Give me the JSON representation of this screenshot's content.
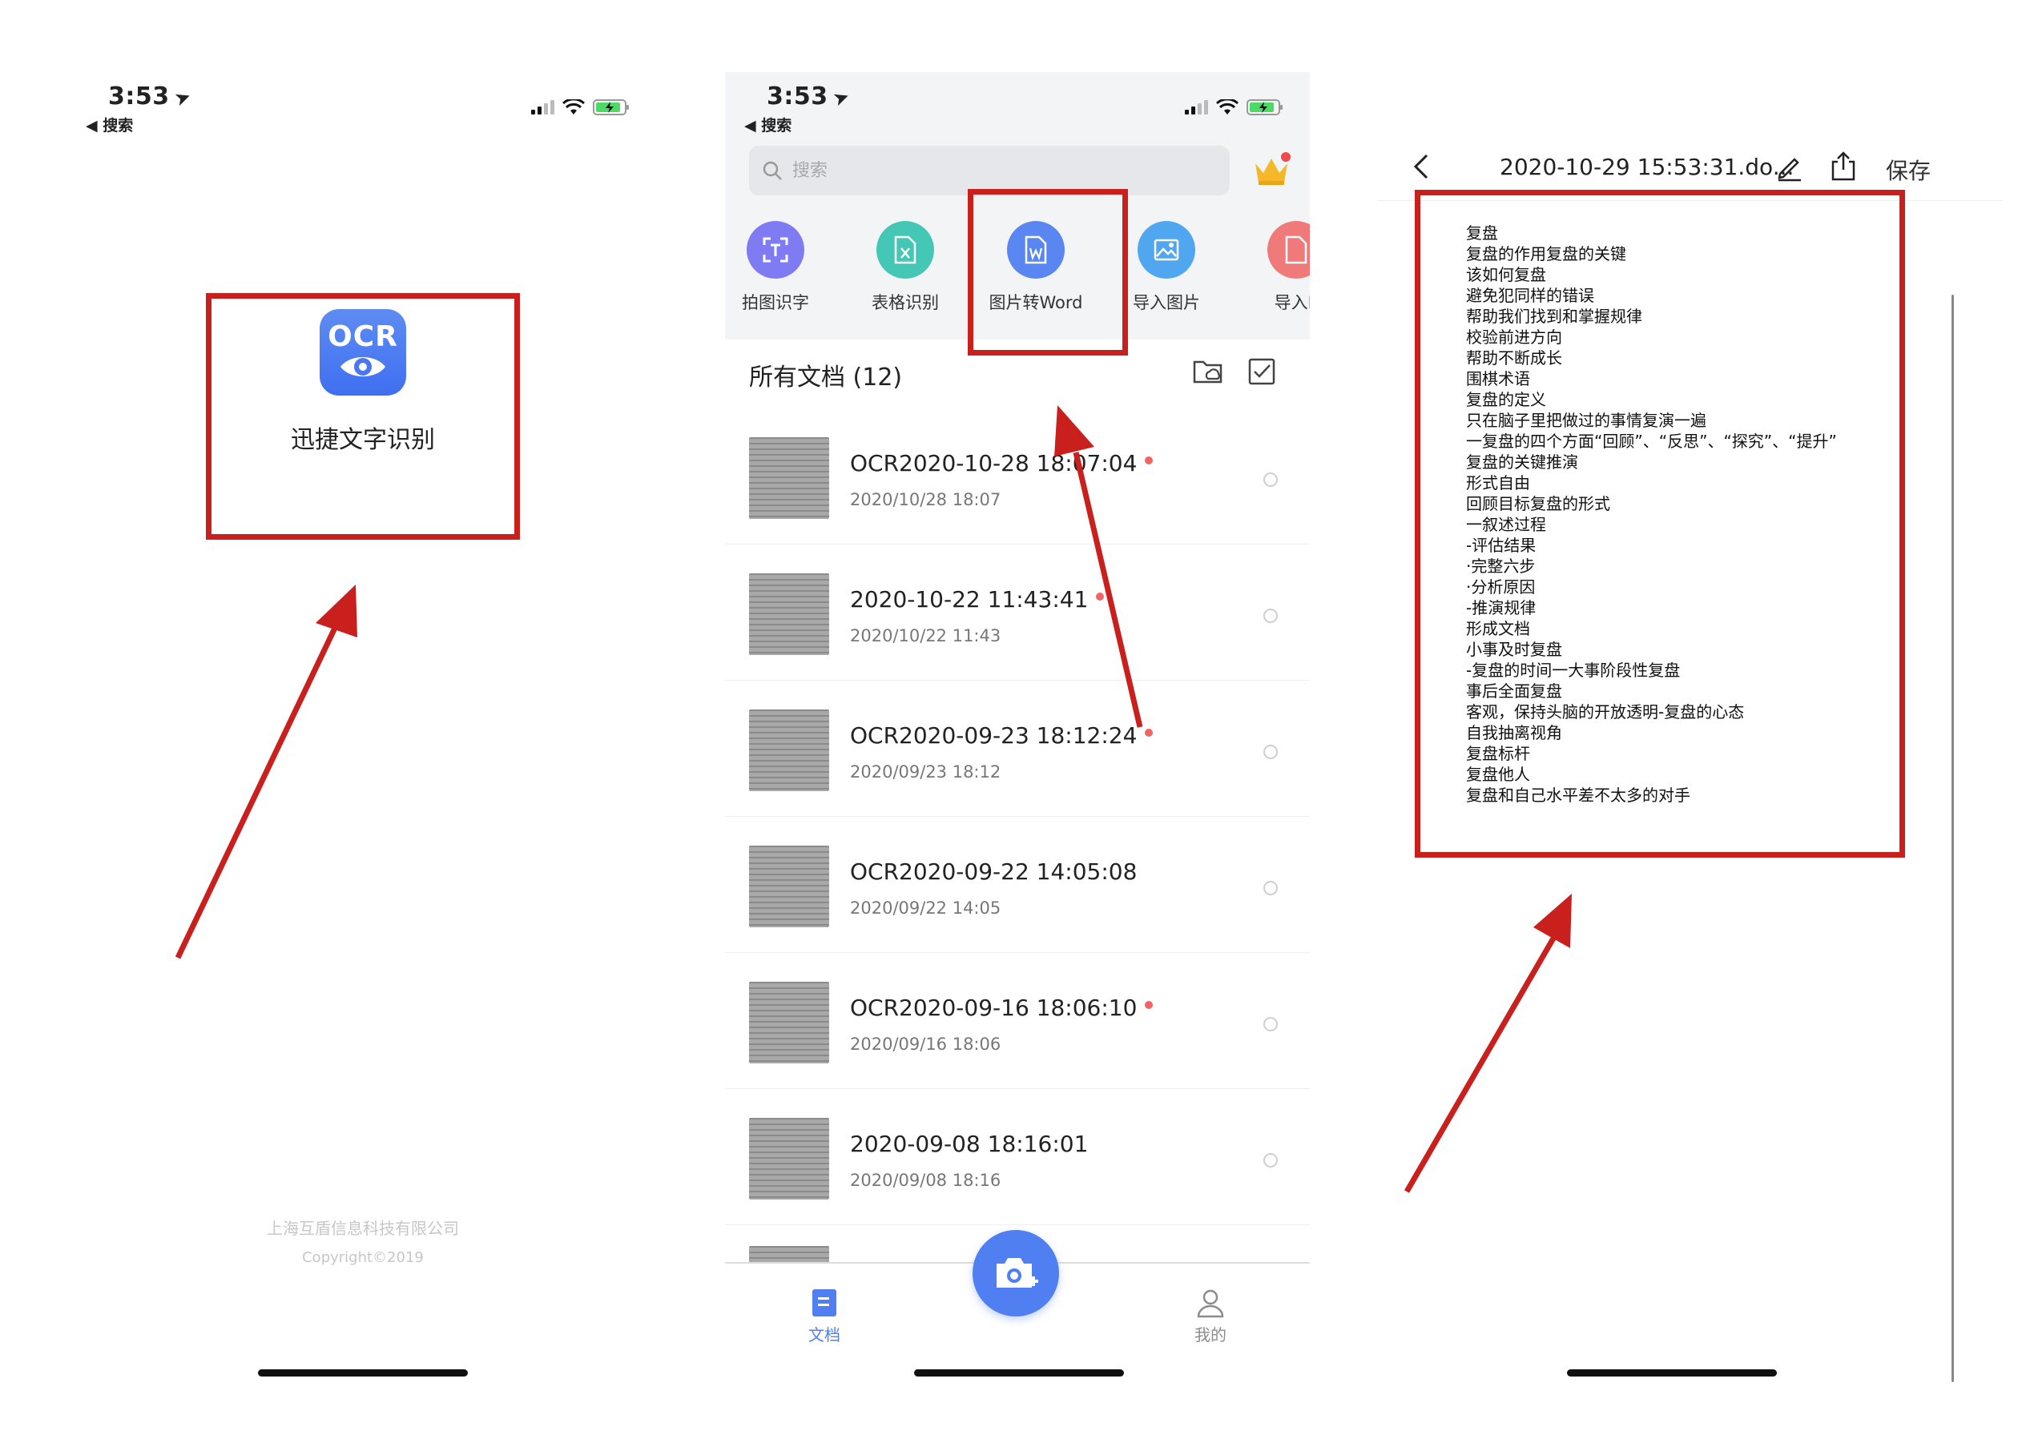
{
  "status_bar": {
    "time": "3:53",
    "back_label": "◀ 搜索"
  },
  "splash": {
    "icon_text": "OCR",
    "app_name": "迅捷文字识别",
    "company": "上海互盾信息科技有限公司",
    "copyright": "Copyright©2019"
  },
  "home": {
    "search_placeholder": "搜索",
    "tools": [
      {
        "label": "拍图识字",
        "icon": "scan-text-icon",
        "color": "#7f7cf3"
      },
      {
        "label": "表格识别",
        "icon": "excel-file-icon",
        "color": "#45c7b6"
      },
      {
        "label": "图片转Word",
        "icon": "word-file-icon",
        "color": "#5a86f2"
      },
      {
        "label": "导入图片",
        "icon": "import-image-icon",
        "color": "#50a6ef"
      },
      {
        "label": "导入P",
        "icon": "import-pdf-icon",
        "color": "#f07a7a"
      }
    ],
    "all_docs_label": "所有文档 (12)",
    "documents": [
      {
        "title": "OCR2020-10-28 18:07:04",
        "date": "2020/10/28 18:07",
        "unread": true
      },
      {
        "title": "2020-10-22 11:43:41",
        "date": "2020/10/22 11:43",
        "unread": true
      },
      {
        "title": "OCR2020-09-23 18:12:24",
        "date": "2020/09/23 18:12",
        "unread": true
      },
      {
        "title": "OCR2020-09-22 14:05:08",
        "date": "2020/09/22 14:05",
        "unread": false
      },
      {
        "title": "OCR2020-09-16 18:06:10",
        "date": "2020/09/16 18:06",
        "unread": true
      },
      {
        "title": "2020-09-08 18:16:01",
        "date": "2020/09/08 18:16",
        "unread": false
      }
    ],
    "tabs": {
      "documents": "文档",
      "mine": "我的"
    },
    "accent": "#4f7ff0"
  },
  "editor": {
    "title": "2020-10-29 15:53:31.do...",
    "save_label": "保存",
    "lines": [
      "复盘",
      "复盘的作用复盘的关键",
      "该如何复盘",
      "避免犯同样的错误",
      "帮助我们找到和掌握规律",
      "校验前进方向",
      "帮助不断成长",
      "围棋术语",
      "复盘的定义",
      "只在脑子里把做过的事情复演一遍",
      "一复盘的四个方面“回顾”、“反思”、“探究”、“提升”",
      "复盘的关键推演",
      "形式自由",
      "回顾目标复盘的形式",
      "一叙述过程",
      "-评估结果",
      "·完整六步",
      "·分析原因",
      "-推演规律",
      "形成文档",
      "小事及时复盘",
      "-复盘的时间一大事阶段性复盘",
      "事后全面复盘",
      "客观，保持头脑的开放透明-复盘的心态",
      "自我抽离视角",
      "复盘标杆",
      "复盘他人",
      "复盘和自己水平差不太多的对手"
    ]
  },
  "annotation_color": "#c9201e"
}
